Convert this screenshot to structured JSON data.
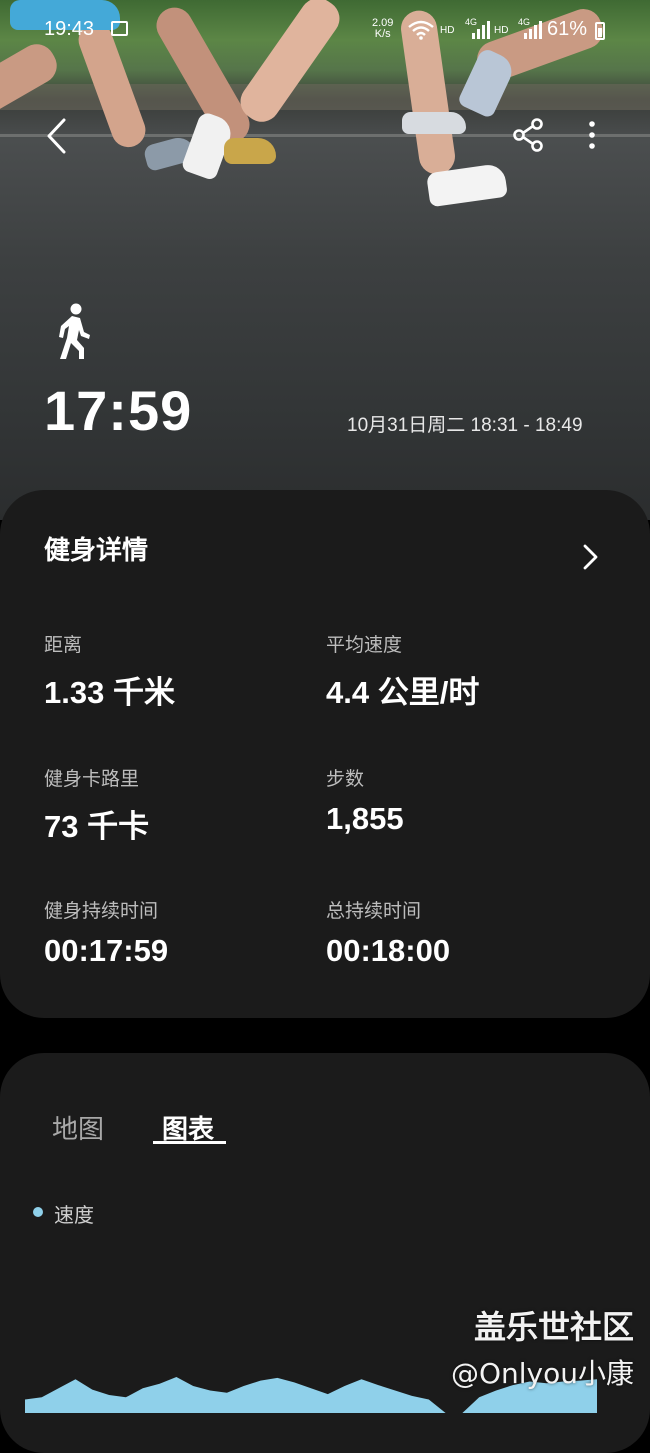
{
  "status_bar": {
    "time": "19:43",
    "net_speed_value": "2.09",
    "net_speed_unit": "K/s",
    "hd1": "HD",
    "hd2": "HD",
    "net_type1": "4G",
    "net_type2": "4G",
    "battery": "61%"
  },
  "header": {
    "activity_icon": "walking-icon",
    "duration": "17:59",
    "date_range": "10月31日周二 18:31 - 18:49"
  },
  "details": {
    "title": "健身详情",
    "metrics": [
      {
        "label": "距离",
        "value": "1.33 千米"
      },
      {
        "label": "平均速度",
        "value": "4.4 公里/时"
      },
      {
        "label": "健身卡路里",
        "value": "73 千卡"
      },
      {
        "label": "步数",
        "value": "1,855"
      },
      {
        "label": "健身持续时间",
        "value": "00:17:59"
      },
      {
        "label": "总持续时间",
        "value": "00:18:00"
      }
    ]
  },
  "chart_section": {
    "tabs": [
      {
        "label": "地图",
        "selected": false
      },
      {
        "label": "图表",
        "selected": true
      }
    ],
    "legend": "速度",
    "series_color": "#8fd0ea"
  },
  "watermark": {
    "line1": "盖乐世社区",
    "line2": "@Onlyou小康"
  },
  "chart_data": {
    "type": "area",
    "title": "",
    "series": [
      {
        "name": "速度",
        "values": [
          0.3,
          0.35,
          0.55,
          0.75,
          0.52,
          0.4,
          0.35,
          0.55,
          0.65,
          0.8,
          0.6,
          0.5,
          0.45,
          0.6,
          0.72,
          0.78,
          0.68,
          0.55,
          0.42,
          0.6,
          0.75,
          0.62,
          0.5,
          0.38,
          0.3,
          0.0,
          0.0,
          0.35,
          0.5,
          0.62,
          0.7,
          0.66,
          0.7,
          0.72,
          0.75
        ]
      }
    ],
    "grid": false
  }
}
